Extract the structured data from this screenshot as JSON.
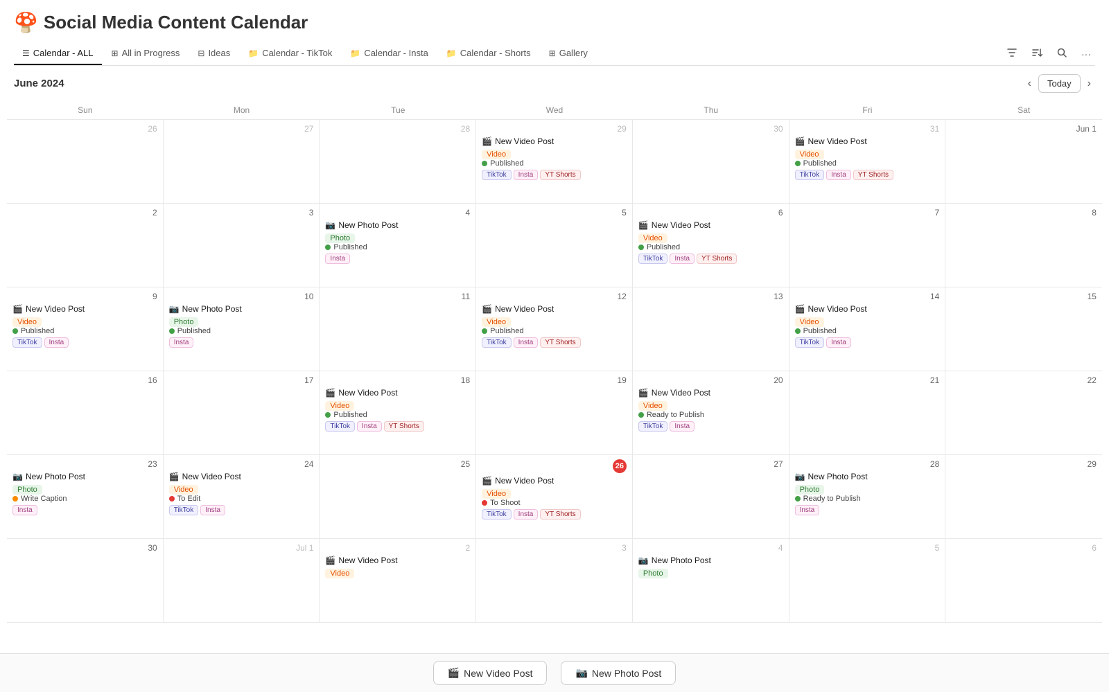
{
  "app": {
    "emoji": "🍄",
    "title": "Social Media Content Calendar"
  },
  "nav": {
    "tabs": [
      {
        "id": "calendar-all",
        "label": "Calendar - ALL",
        "icon": "☰",
        "active": true
      },
      {
        "id": "all-in-progress",
        "label": "All in Progress",
        "icon": "⊞",
        "active": false
      },
      {
        "id": "ideas",
        "label": "Ideas",
        "icon": "⊟",
        "active": false
      },
      {
        "id": "calendar-tiktok",
        "label": "Calendar - TikTok",
        "icon": "📁",
        "active": false
      },
      {
        "id": "calendar-insta",
        "label": "Calendar - Insta",
        "icon": "📁",
        "active": false
      },
      {
        "id": "calendar-shorts",
        "label": "Calendar - Shorts",
        "icon": "📁",
        "active": false
      },
      {
        "id": "gallery",
        "label": "Gallery",
        "icon": "⊞",
        "active": false
      }
    ]
  },
  "calendar": {
    "month_title": "June 2024",
    "today_label": "Today",
    "day_headers": [
      "Sun",
      "Mon",
      "Tue",
      "Wed",
      "Thu",
      "Fri",
      "Sat"
    ],
    "rows": [
      {
        "cells": [
          {
            "day": 26,
            "other_month": true,
            "events": []
          },
          {
            "day": 27,
            "other_month": true,
            "events": []
          },
          {
            "day": 28,
            "other_month": true,
            "events": []
          },
          {
            "day": 29,
            "other_month": true,
            "events": [
              {
                "title": "New Video Post",
                "emoji": "🎬",
                "type": "video",
                "status": "Published",
                "status_class": "published",
                "platforms": [
                  "TikTok",
                  "Insta",
                  "YT Shorts"
                ]
              }
            ]
          },
          {
            "day": 30,
            "other_month": true,
            "events": []
          },
          {
            "day": 31,
            "other_month": true,
            "events": [
              {
                "title": "New Video Post",
                "emoji": "🎬",
                "type": "video",
                "status": "Published",
                "status_class": "published",
                "platforms": [
                  "TikTok",
                  "Insta",
                  "YT Shorts"
                ]
              }
            ]
          },
          {
            "day": 1,
            "other_month": false,
            "label": "Jun 1",
            "events": []
          }
        ]
      },
      {
        "cells": [
          {
            "day": 2,
            "events": []
          },
          {
            "day": 3,
            "events": []
          },
          {
            "day": 4,
            "events": [
              {
                "title": "New Photo Post",
                "emoji": "📷",
                "type": "photo",
                "status": "Published",
                "status_class": "published",
                "platforms": [
                  "Insta"
                ]
              }
            ]
          },
          {
            "day": 5,
            "events": []
          },
          {
            "day": 6,
            "events": [
              {
                "title": "New Video Post",
                "emoji": "🎬",
                "type": "video",
                "status": "Published",
                "status_class": "published",
                "platforms": [
                  "TikTok",
                  "Insta",
                  "YT Shorts"
                ]
              }
            ]
          },
          {
            "day": 7,
            "events": []
          },
          {
            "day": 8,
            "events": []
          }
        ]
      },
      {
        "cells": [
          {
            "day": 9,
            "events": [
              {
                "title": "New Video Post",
                "emoji": "🎬",
                "type": "video",
                "status": "Published",
                "status_class": "published",
                "platforms": [
                  "TikTok",
                  "Insta"
                ]
              }
            ]
          },
          {
            "day": 10,
            "events": [
              {
                "title": "New Photo Post",
                "emoji": "📷",
                "type": "photo",
                "status": "Published",
                "status_class": "published",
                "platforms": [
                  "Insta"
                ]
              }
            ]
          },
          {
            "day": 11,
            "events": []
          },
          {
            "day": 12,
            "events": [
              {
                "title": "New Video Post",
                "emoji": "🎬",
                "type": "video",
                "status": "Published",
                "status_class": "published",
                "platforms": [
                  "TikTok",
                  "Insta",
                  "YT Shorts"
                ]
              }
            ]
          },
          {
            "day": 13,
            "events": []
          },
          {
            "day": 14,
            "events": [
              {
                "title": "New Video Post",
                "emoji": "🎬",
                "type": "video",
                "status": "Published",
                "status_class": "published",
                "platforms": [
                  "TikTok",
                  "Insta"
                ]
              }
            ]
          },
          {
            "day": 15,
            "events": []
          }
        ]
      },
      {
        "cells": [
          {
            "day": 16,
            "events": []
          },
          {
            "day": 17,
            "events": []
          },
          {
            "day": 18,
            "events": [
              {
                "title": "New Video Post",
                "emoji": "🎬",
                "type": "video",
                "status": "Published",
                "status_class": "published",
                "platforms": [
                  "TikTok",
                  "Insta",
                  "YT Shorts"
                ]
              }
            ]
          },
          {
            "day": 19,
            "events": []
          },
          {
            "day": 20,
            "events": [
              {
                "title": "New Video Post",
                "emoji": "🎬",
                "type": "video",
                "status": "Ready to Publish",
                "status_class": "ready",
                "platforms": [
                  "TikTok",
                  "Insta"
                ]
              }
            ]
          },
          {
            "day": 21,
            "events": []
          },
          {
            "day": 22,
            "events": []
          }
        ]
      },
      {
        "cells": [
          {
            "day": 23,
            "events": [
              {
                "title": "New Photo Post",
                "emoji": "📷",
                "type": "photo",
                "status": "Write Caption",
                "status_class": "write-caption",
                "platforms": [
                  "Insta"
                ]
              }
            ]
          },
          {
            "day": 24,
            "events": [
              {
                "title": "New Video Post",
                "emoji": "🎬",
                "type": "video",
                "status": "To Edit",
                "status_class": "to-edit",
                "platforms": [
                  "TikTok",
                  "Insta"
                ]
              }
            ]
          },
          {
            "day": 25,
            "events": []
          },
          {
            "day": 26,
            "today": true,
            "events": [
              {
                "title": "New Video Post",
                "emoji": "🎬",
                "type": "video",
                "status": "To Shoot",
                "status_class": "to-shoot",
                "platforms": [
                  "TikTok",
                  "Insta",
                  "YT Shorts"
                ]
              }
            ]
          },
          {
            "day": 27,
            "events": []
          },
          {
            "day": 28,
            "events": [
              {
                "title": "New Photo Post",
                "emoji": "📷",
                "type": "photo",
                "status": "Ready to Publish",
                "status_class": "ready",
                "platforms": [
                  "Insta"
                ]
              }
            ]
          },
          {
            "day": 29,
            "events": []
          }
        ]
      },
      {
        "cells": [
          {
            "day": 30,
            "events": []
          },
          {
            "day": 1,
            "other_month": true,
            "label": "Jul 1",
            "events": []
          },
          {
            "day": 2,
            "other_month": true,
            "events": [
              {
                "title": "New Video Post",
                "emoji": "🎬",
                "type": "video",
                "status": "",
                "status_class": "",
                "platforms": []
              }
            ]
          },
          {
            "day": 3,
            "other_month": true,
            "events": []
          },
          {
            "day": 4,
            "other_month": true,
            "events": [
              {
                "title": "New Photo Post",
                "emoji": "📷",
                "type": "photo",
                "status": "",
                "status_class": "",
                "platforms": []
              }
            ]
          },
          {
            "day": 5,
            "other_month": true,
            "events": []
          },
          {
            "day": 6,
            "other_month": true,
            "events": []
          }
        ]
      }
    ]
  },
  "footer": {
    "new_photo_btn": "New Photo Post",
    "new_video_btn": "New Video Post"
  }
}
